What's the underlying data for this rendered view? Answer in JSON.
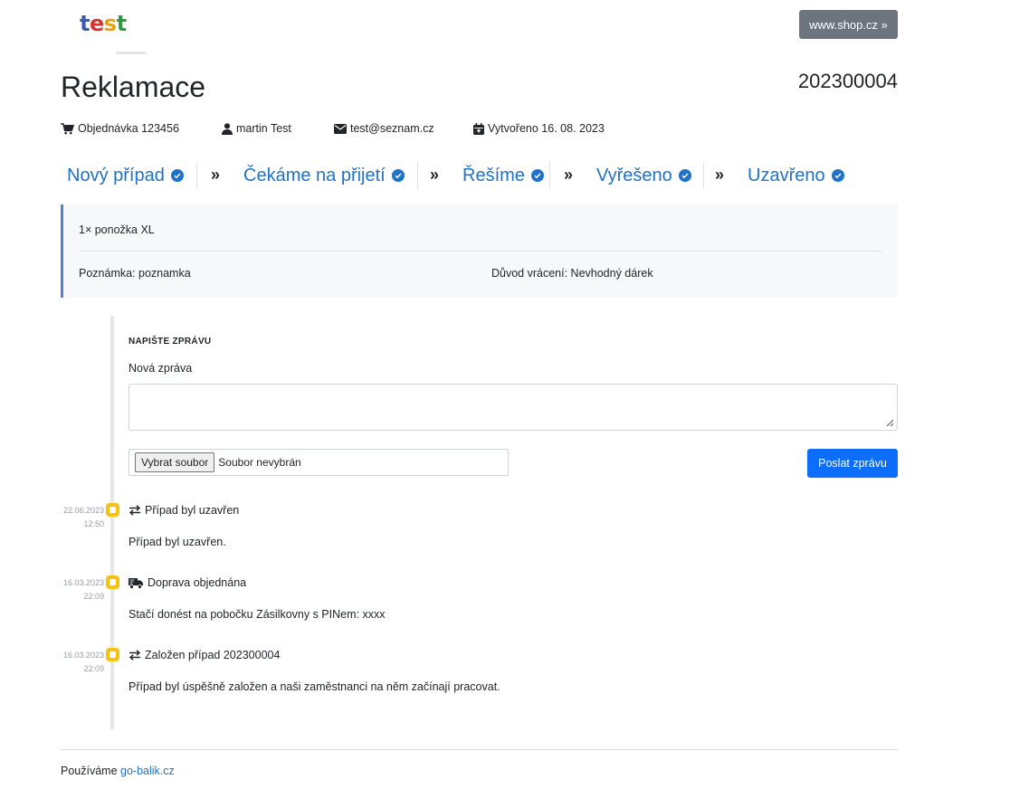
{
  "header": {
    "logo_text": [
      "t",
      "e",
      "s",
      "t"
    ],
    "shop_link": "www.shop.cz »"
  },
  "page": {
    "title": "Reklamace",
    "case_number": "202300004"
  },
  "meta": {
    "order": "Objednávka 123456",
    "customer": "martin Test",
    "email": "test@seznam.cz",
    "created": "Vytvořeno 16. 08. 2023"
  },
  "steps": [
    {
      "label": "Nový případ"
    },
    {
      "label": "Čekáme na přijetí"
    },
    {
      "label": "Řešíme"
    },
    {
      "label": "Vyřešeno"
    },
    {
      "label": "Uzavřeno"
    }
  ],
  "step_separator": "»",
  "item": {
    "name": "1× ponožka XL",
    "note": "Poznámka: poznamka",
    "reason": "Důvod vrácení: Nevhodný dárek"
  },
  "message_form": {
    "heading": "NAPIŠTE ZPRÁVU",
    "label": "Nová zpráva",
    "textarea_value": "",
    "file_button": "Vybrat soubor",
    "file_status": "Soubor nevybrán",
    "send_button": "Poslat zprávu"
  },
  "events": [
    {
      "date": "22.06.2023",
      "time": "12:50",
      "icon": "exchange-icon",
      "title": "Případ byl uzavřen",
      "text": "Případ byl uzavřen."
    },
    {
      "date": "16.03.2023",
      "time": "22:09",
      "icon": "truck-icon",
      "title": "Doprava objednána",
      "text": "Stačí donést na pobočku Zásilkovny s PINem: xxxx"
    },
    {
      "date": "16.03.2023",
      "time": "22:09",
      "icon": "exchange-icon",
      "title": "Založen případ 202300004",
      "text": "Případ byl úspěšně založen a naši zaměstnanci na něm začínají pracovat."
    }
  ],
  "footer": {
    "prefix": "Používáme",
    "link": "go-balik.cz"
  },
  "colors": {
    "accent": "#1f72c9",
    "primary_button": "#0d6efd",
    "event_dot": "#f5c211",
    "secondary_button": "#6c757d"
  }
}
